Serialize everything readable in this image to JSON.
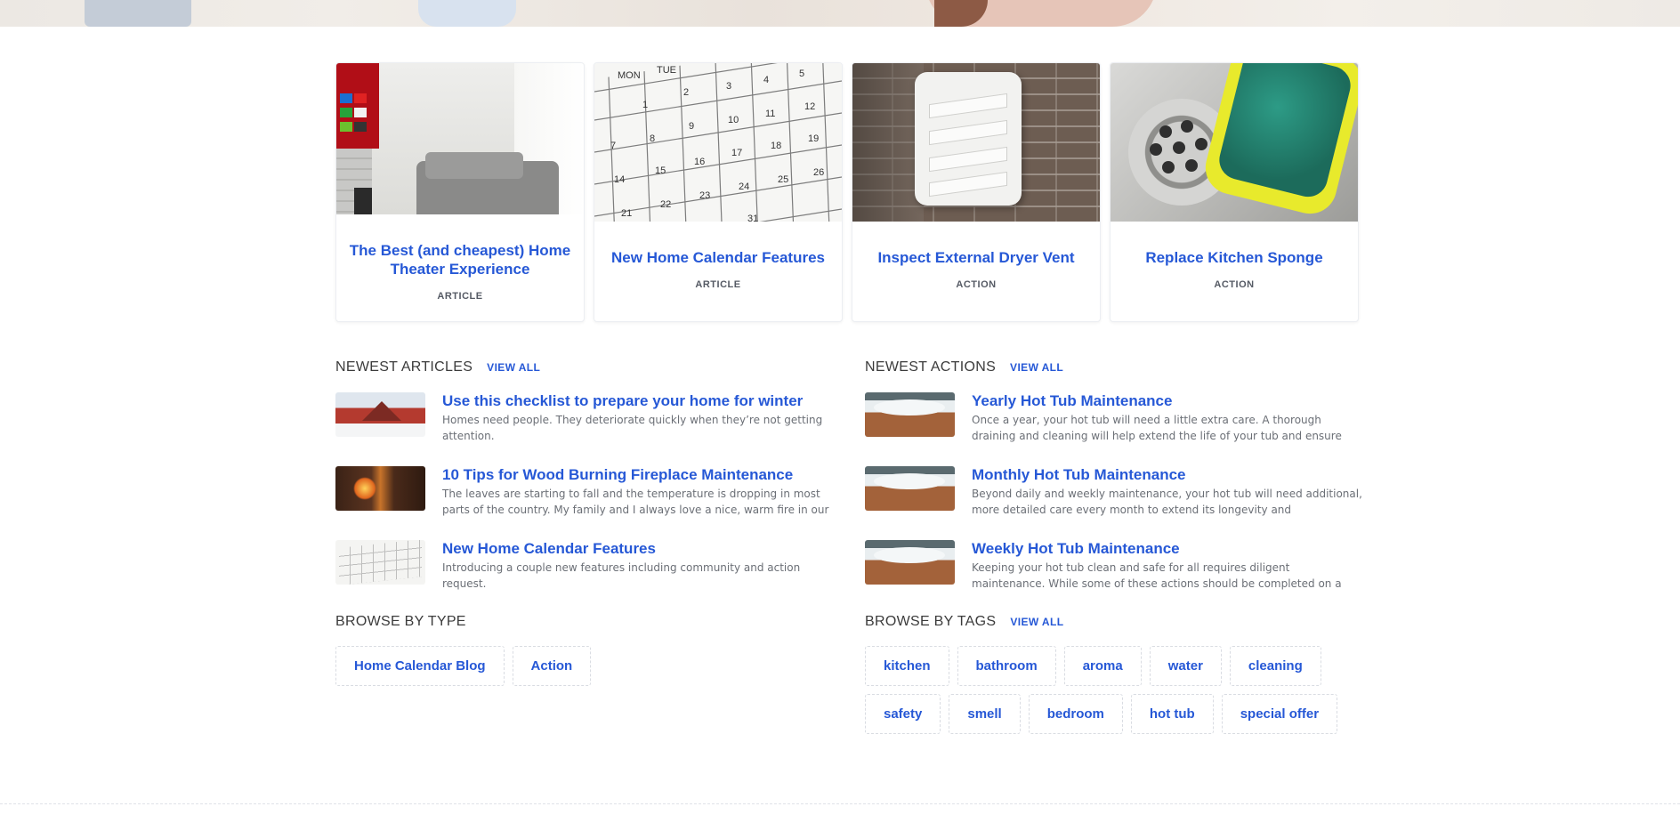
{
  "featured": [
    {
      "title": "The Best (and cheapest) Home Theater Experience",
      "type": "ARTICLE"
    },
    {
      "title": "New Home Calendar Features",
      "type": "ARTICLE"
    },
    {
      "title": "Inspect External Dryer Vent",
      "type": "ACTION"
    },
    {
      "title": "Replace Kitchen Sponge",
      "type": "ACTION"
    }
  ],
  "calendar_image": {
    "days": [
      "MON",
      "TUE"
    ],
    "numbers": [
      "5",
      "4",
      "3",
      "2",
      "1",
      "12",
      "11",
      "10",
      "9",
      "8",
      "7",
      "19",
      "18",
      "17",
      "16",
      "15",
      "14",
      "26",
      "25",
      "24",
      "23",
      "22",
      "21",
      "31"
    ]
  },
  "newest_articles": {
    "title": "NEWEST ARTICLES",
    "view_all": "VIEW ALL",
    "items": [
      {
        "title": "Use this checklist to prepare your home for winter",
        "desc": "Homes need people. They deteriorate quickly when they’re not getting attention."
      },
      {
        "title": "10 Tips for Wood Burning Fireplace Maintenance",
        "desc": "The leaves are starting to fall and the temperature is dropping in most parts of the country. My family and I always love a nice, warm fire in our"
      },
      {
        "title": "New Home Calendar Features",
        "desc": "Introducing a couple new features including community and action request."
      }
    ]
  },
  "newest_actions": {
    "title": "NEWEST ACTIONS",
    "view_all": "VIEW ALL",
    "items": [
      {
        "title": "Yearly Hot Tub Maintenance",
        "desc": "Once a year, your hot tub will need a little extra care. A thorough draining and cleaning will help extend the life of your tub and ensure"
      },
      {
        "title": "Monthly Hot Tub Maintenance",
        "desc": "Beyond daily and weekly maintenance, your hot tub will need additional, more detailed care every month to extend its longevity and"
      },
      {
        "title": "Weekly Hot Tub Maintenance",
        "desc": "Keeping your hot tub clean and safe for all requires diligent maintenance. While some of these actions should be completed on a"
      }
    ]
  },
  "browse_type": {
    "title": "BROWSE BY TYPE",
    "items": [
      "Home Calendar Blog",
      "Action"
    ]
  },
  "browse_tags": {
    "title": "BROWSE BY TAGS",
    "view_all": "VIEW ALL",
    "items": [
      "kitchen",
      "bathroom",
      "aroma",
      "water",
      "cleaning",
      "safety",
      "smell",
      "bedroom",
      "hot tub",
      "special offer"
    ]
  },
  "colors": {
    "link": "#2658d6",
    "text": "#3b3b3b",
    "muted": "#6b6f76"
  }
}
